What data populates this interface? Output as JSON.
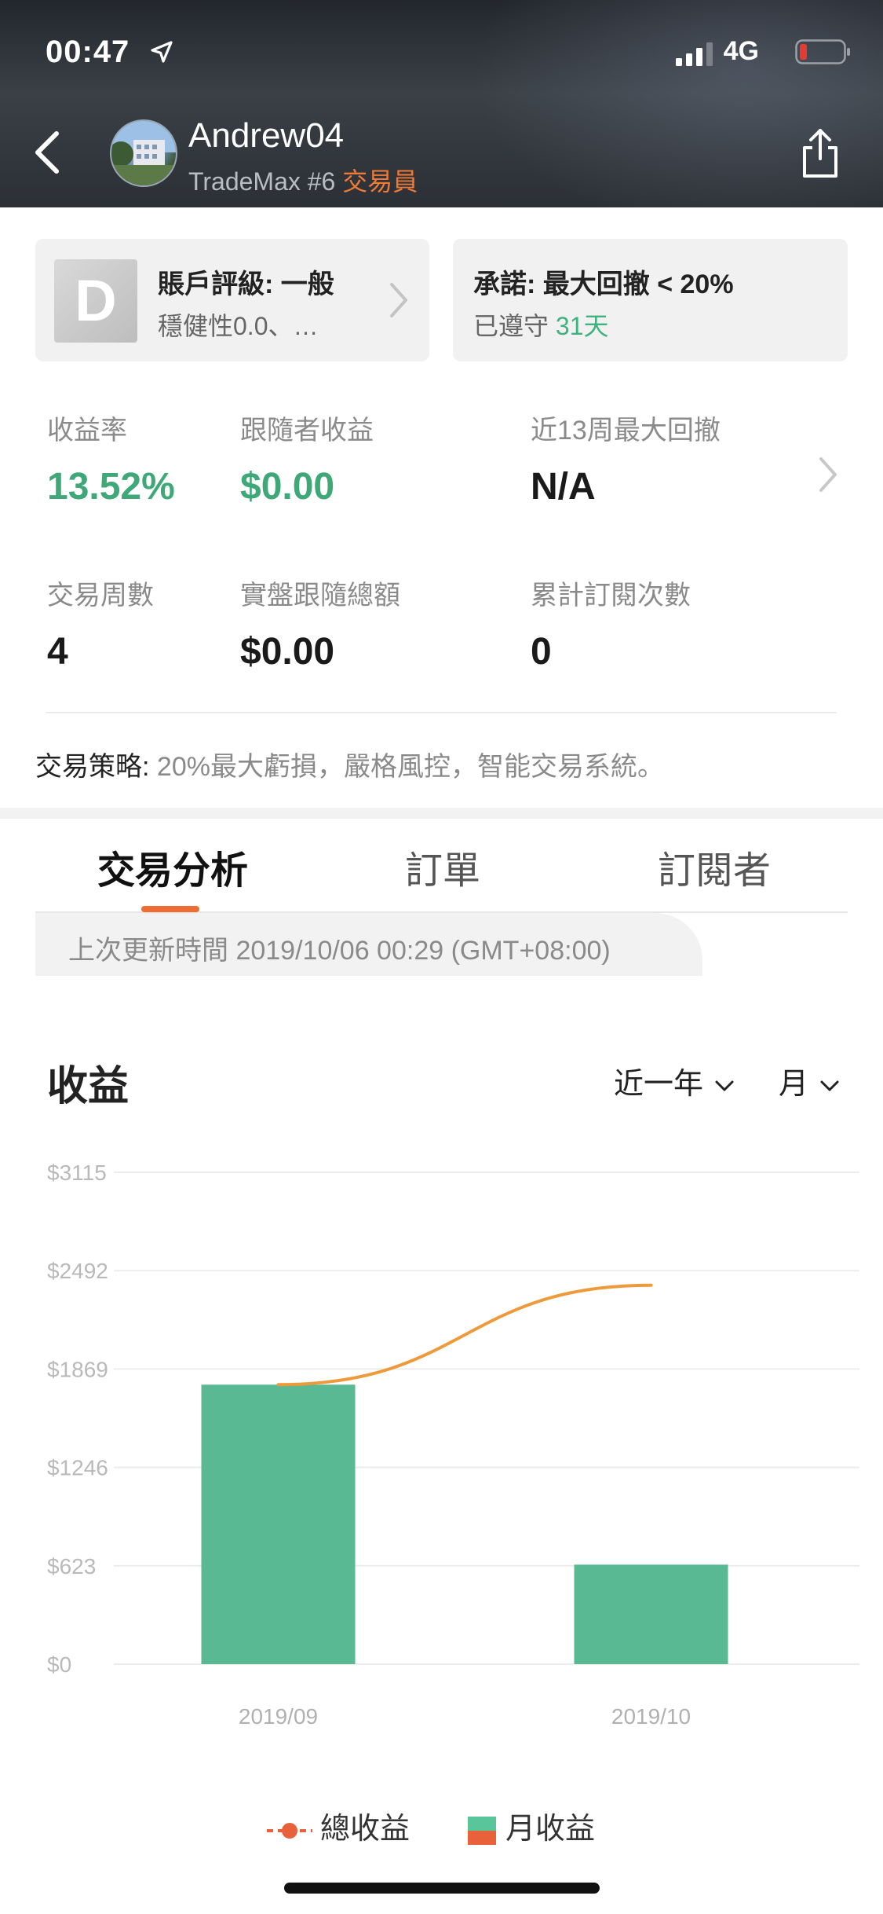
{
  "status_bar": {
    "time": "00:47",
    "network": "4G"
  },
  "profile": {
    "name": "Andrew04",
    "platform": "TradeMax #6",
    "role": "交易員"
  },
  "cards": {
    "rating": {
      "badge": "D",
      "title": "賬戶評級: 一般",
      "subtitle": "穩健性0.0、…"
    },
    "commitment": {
      "title": "承諾: 最大回撤 < 20%",
      "subtitle_prefix": "已遵守",
      "days": "31天"
    }
  },
  "stats": {
    "return_label": "收益率",
    "return_value": "13.52%",
    "follower_profit_label": "跟隨者收益",
    "follower_profit_value": "$0.00",
    "max_drawdown_label": "近13周最大回撤",
    "max_drawdown_value": "N/A",
    "weeks_label": "交易周數",
    "weeks_value": "4",
    "live_total_label": "實盤跟隨總額",
    "live_total_value": "$0.00",
    "subs_label": "累計訂閱次數",
    "subs_value": "0"
  },
  "strategy": {
    "label": "交易策略:",
    "value": "20%最大虧損，嚴格風控，智能交易系統。"
  },
  "tabs": [
    {
      "label": "交易分析",
      "active": true
    },
    {
      "label": "訂單",
      "active": false
    },
    {
      "label": "訂閱者",
      "active": false
    }
  ],
  "updated": "上次更新時間 2019/10/06 00:29 (GMT+08:00)",
  "section": {
    "title": "收益",
    "range": "近一年",
    "period": "月"
  },
  "chart_data": {
    "type": "bar",
    "categories": [
      "2019/09",
      "2019/10"
    ],
    "series": [
      {
        "name": "月收益",
        "type": "bar",
        "values": [
          1770,
          630
        ],
        "color": "#58b993"
      },
      {
        "name": "總收益",
        "type": "line",
        "values": [
          1770,
          2400
        ],
        "color": "#ee9a3a"
      }
    ],
    "y_ticks": [
      "$0",
      "$623",
      "$1246",
      "$1869",
      "$2492",
      "$3115"
    ],
    "ylim": [
      0,
      3115
    ],
    "grid": true,
    "legend": "bottom"
  },
  "legend": {
    "line_label": "總收益",
    "bar_label": "月收益"
  }
}
